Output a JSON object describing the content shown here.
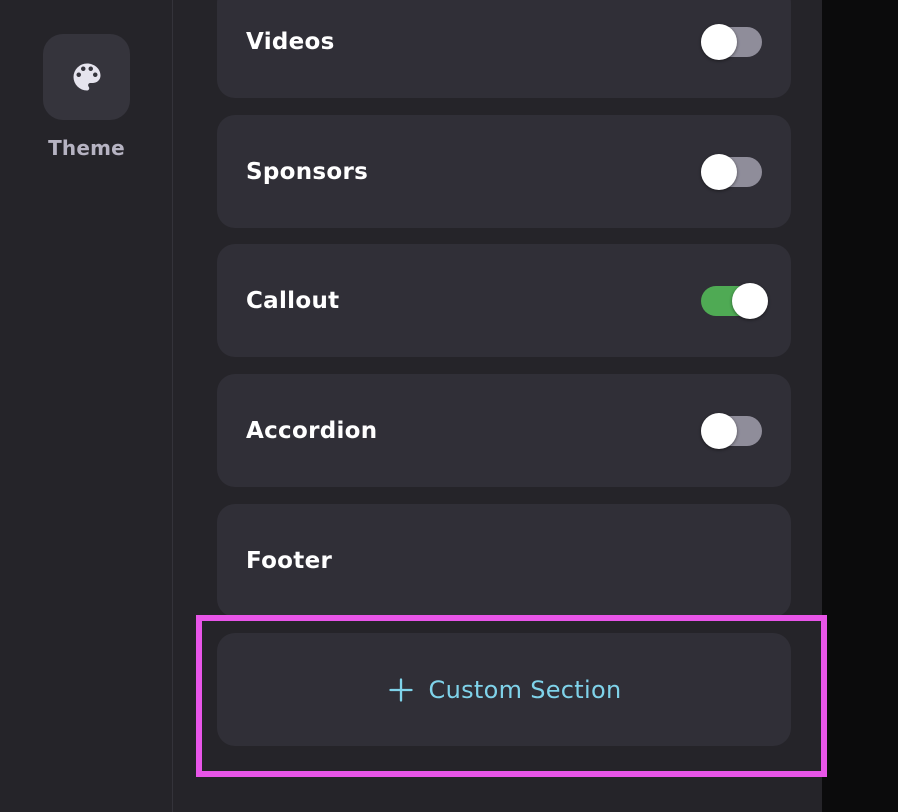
{
  "sidebar": {
    "theme_label": "Theme",
    "theme_icon": "palette-icon"
  },
  "sections": [
    {
      "label": "Videos",
      "toggle": false
    },
    {
      "label": "Sponsors",
      "toggle": false
    },
    {
      "label": "Callout",
      "toggle": true
    },
    {
      "label": "Accordion",
      "toggle": false
    },
    {
      "label": "Footer"
    }
  ],
  "custom_section": {
    "label": "Custom Section",
    "icon": "plus-icon"
  },
  "colors": {
    "toggle_on": "#4faa54",
    "toggle_off": "#8f8d9a",
    "accent": "#7fd3ea",
    "highlight": "#e855e8"
  }
}
